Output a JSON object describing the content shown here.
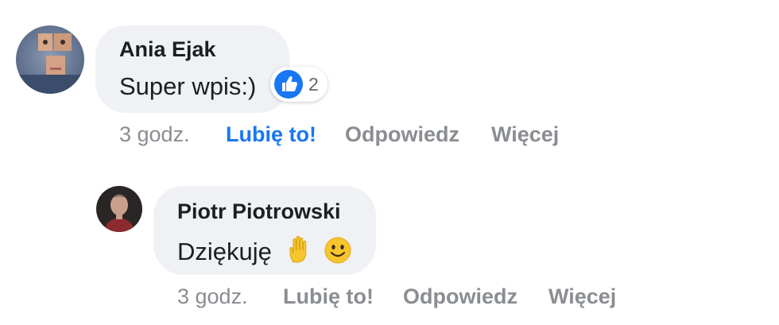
{
  "colors": {
    "bubble": "#eff1f4",
    "liked_accent": "#1877f2",
    "muted": "#8a8d91",
    "text": "#1c1e21"
  },
  "comments": [
    {
      "author": "Ania Ejak",
      "text": "Super wpis:)",
      "reaction": {
        "icon": "thumbs-up-icon",
        "count": "2"
      },
      "time": "3 godz.",
      "like_label": "Lubię to!",
      "liked": true,
      "reply_label": "Odpowiedz",
      "more_label": "Więcej"
    },
    {
      "author": "Piotr Piotrowski",
      "text": "Dziękuję",
      "emojis": [
        "raised-hand-icon",
        "smiley-icon"
      ],
      "time": "3 godz.",
      "like_label": "Lubię to!",
      "liked": false,
      "reply_label": "Odpowiedz",
      "more_label": "Więcej"
    }
  ]
}
